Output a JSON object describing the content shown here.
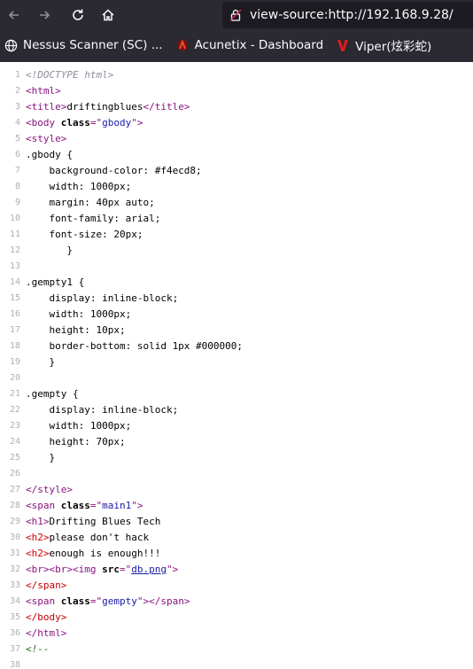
{
  "browser": {
    "url": "view-source:http://192.168.9.28/",
    "bookmarks": [
      {
        "label": "Nessus Scanner (SC) ...",
        "icon": "globe-icon"
      },
      {
        "label": "Acunetix - Dashboard",
        "icon": "acunetix-icon"
      },
      {
        "label": "Viper(炫彩蛇)",
        "icon": "viper-icon"
      }
    ]
  },
  "source_lines": [
    {
      "n": "1",
      "parts": [
        {
          "t": "<!DOCTYPE html>",
          "c": "doctype"
        }
      ]
    },
    {
      "n": "2",
      "parts": [
        {
          "t": "<html>",
          "c": "tag"
        }
      ]
    },
    {
      "n": "3",
      "parts": [
        {
          "t": "<title>",
          "c": "tag"
        },
        {
          "t": "driftingblues",
          "c": ""
        },
        {
          "t": "</title>",
          "c": "tag"
        }
      ]
    },
    {
      "n": "4",
      "parts": [
        {
          "t": "<body ",
          "c": "tag"
        },
        {
          "t": "class",
          "c": "attr"
        },
        {
          "t": "=\"",
          "c": "tag"
        },
        {
          "t": "gbody",
          "c": "val"
        },
        {
          "t": "\">",
          "c": "tag"
        }
      ]
    },
    {
      "n": "5",
      "parts": [
        {
          "t": "<style>",
          "c": "tag"
        }
      ]
    },
    {
      "n": "6",
      "parts": [
        {
          "t": ".gbody {",
          "c": ""
        }
      ]
    },
    {
      "n": "7",
      "parts": [
        {
          "t": "    background-color: #f4ecd8;",
          "c": ""
        }
      ]
    },
    {
      "n": "8",
      "parts": [
        {
          "t": "    width: 1000px;",
          "c": ""
        }
      ]
    },
    {
      "n": "9",
      "parts": [
        {
          "t": "    margin: 40px auto;",
          "c": ""
        }
      ]
    },
    {
      "n": "10",
      "parts": [
        {
          "t": "    font-family: arial;",
          "c": ""
        }
      ]
    },
    {
      "n": "11",
      "parts": [
        {
          "t": "    font-size: 20px;",
          "c": ""
        }
      ]
    },
    {
      "n": "12",
      "parts": [
        {
          "t": "       }",
          "c": ""
        }
      ]
    },
    {
      "n": "13",
      "parts": []
    },
    {
      "n": "14",
      "parts": [
        {
          "t": ".gempty1 {",
          "c": ""
        }
      ]
    },
    {
      "n": "15",
      "parts": [
        {
          "t": "    display: inline-block;",
          "c": ""
        }
      ]
    },
    {
      "n": "16",
      "parts": [
        {
          "t": "    width: 1000px;",
          "c": ""
        }
      ]
    },
    {
      "n": "17",
      "parts": [
        {
          "t": "    height: 10px;",
          "c": ""
        }
      ]
    },
    {
      "n": "18",
      "parts": [
        {
          "t": "    border-bottom: solid 1px #000000;",
          "c": ""
        }
      ]
    },
    {
      "n": "19",
      "parts": [
        {
          "t": "    }",
          "c": ""
        }
      ]
    },
    {
      "n": "20",
      "parts": []
    },
    {
      "n": "21",
      "parts": [
        {
          "t": ".gempty {",
          "c": ""
        }
      ]
    },
    {
      "n": "22",
      "parts": [
        {
          "t": "    display: inline-block;",
          "c": ""
        }
      ]
    },
    {
      "n": "23",
      "parts": [
        {
          "t": "    width: 1000px;",
          "c": ""
        }
      ]
    },
    {
      "n": "24",
      "parts": [
        {
          "t": "    height: 70px;",
          "c": ""
        }
      ]
    },
    {
      "n": "25",
      "parts": [
        {
          "t": "    }",
          "c": ""
        }
      ]
    },
    {
      "n": "26",
      "parts": []
    },
    {
      "n": "27",
      "parts": [
        {
          "t": "</style>",
          "c": "tag"
        }
      ]
    },
    {
      "n": "28",
      "parts": [
        {
          "t": "<span ",
          "c": "tag"
        },
        {
          "t": "class",
          "c": "attr"
        },
        {
          "t": "=\"",
          "c": "tag"
        },
        {
          "t": "main1",
          "c": "val"
        },
        {
          "t": "\">",
          "c": "tag"
        }
      ]
    },
    {
      "n": "29",
      "parts": [
        {
          "t": "<h1>",
          "c": "tag"
        },
        {
          "t": "Drifting Blues Tech",
          "c": ""
        }
      ]
    },
    {
      "n": "30",
      "parts": [
        {
          "t": "<h2>",
          "c": "tag red"
        },
        {
          "t": "please don't hack",
          "c": ""
        }
      ]
    },
    {
      "n": "31",
      "parts": [
        {
          "t": "<h2>",
          "c": "tag red"
        },
        {
          "t": "enough is enough!!!",
          "c": ""
        }
      ]
    },
    {
      "n": "32",
      "parts": [
        {
          "t": "<br><br><img ",
          "c": "tag"
        },
        {
          "t": "src",
          "c": "attr"
        },
        {
          "t": "=\"",
          "c": "tag"
        },
        {
          "t": "db.png",
          "c": "link"
        },
        {
          "t": "\">",
          "c": "tag"
        }
      ]
    },
    {
      "n": "33",
      "parts": [
        {
          "t": "</span>",
          "c": "tag red"
        }
      ]
    },
    {
      "n": "34",
      "parts": [
        {
          "t": "<span ",
          "c": "tag"
        },
        {
          "t": "class",
          "c": "attr"
        },
        {
          "t": "=\"",
          "c": "tag"
        },
        {
          "t": "gempty",
          "c": "val"
        },
        {
          "t": "\"></span>",
          "c": "tag"
        }
      ]
    },
    {
      "n": "35",
      "parts": [
        {
          "t": "</body>",
          "c": "tag red"
        }
      ]
    },
    {
      "n": "36",
      "parts": [
        {
          "t": "</html>",
          "c": "tag"
        }
      ]
    },
    {
      "n": "37",
      "parts": [
        {
          "t": "<!--",
          "c": "cmt"
        }
      ]
    },
    {
      "n": "38",
      "parts": []
    }
  ]
}
